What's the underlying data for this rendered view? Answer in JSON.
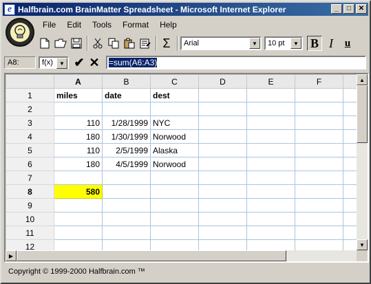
{
  "window": {
    "title": "Halfbrain.com BrainMatter Spreadsheet - Microsoft Internet Explorer",
    "minimize": "_",
    "maximize": "□",
    "close": "✕"
  },
  "menu": [
    "File",
    "Edit",
    "Tools",
    "Format",
    "Help"
  ],
  "toolbar": {
    "font": "Arial",
    "font_size": "10 pt",
    "bold_label": "B",
    "italic_label": "I",
    "underline_label": "u",
    "sum_label": "Σ",
    "new_icon": "new-document-icon",
    "open_icon": "open-folder-icon",
    "save_icon": "save-disk-icon",
    "cut_icon": "cut-scissors-icon",
    "copy_icon": "copy-icon",
    "paste_icon": "paste-clipboard-icon",
    "properties_icon": "properties-icon"
  },
  "formula_bar": {
    "cell_ref": "A8:",
    "fx_label": "f(x)",
    "confirm": "✔",
    "cancel": "✕",
    "formula": "=sum(A6:A3)"
  },
  "grid": {
    "columns": [
      "A",
      "B",
      "C",
      "D",
      "E",
      "F"
    ],
    "rows": [
      {
        "num": "1",
        "cells": [
          "miles",
          "date",
          "dest",
          "",
          "",
          ""
        ]
      },
      {
        "num": "2",
        "cells": [
          "",
          "",
          "",
          "",
          "",
          ""
        ]
      },
      {
        "num": "3",
        "cells": [
          "110",
          "1/28/1999",
          "NYC",
          "",
          "",
          ""
        ]
      },
      {
        "num": "4",
        "cells": [
          "180",
          "1/30/1999",
          "Norwood",
          "",
          "",
          ""
        ]
      },
      {
        "num": "5",
        "cells": [
          "110",
          "2/5/1999",
          "Alaska",
          "",
          "",
          ""
        ]
      },
      {
        "num": "6",
        "cells": [
          "180",
          "4/5/1999",
          "Norwood",
          "",
          "",
          ""
        ]
      },
      {
        "num": "7",
        "cells": [
          "",
          "",
          "",
          "",
          "",
          ""
        ]
      },
      {
        "num": "8",
        "cells": [
          "580",
          "",
          "",
          "",
          "",
          ""
        ]
      },
      {
        "num": "9",
        "cells": [
          "",
          "",
          "",
          "",
          "",
          ""
        ]
      },
      {
        "num": "10",
        "cells": [
          "",
          "",
          "",
          "",
          "",
          ""
        ]
      },
      {
        "num": "11",
        "cells": [
          "",
          "",
          "",
          "",
          "",
          ""
        ]
      },
      {
        "num": "12",
        "cells": [
          "",
          "",
          "",
          "",
          "",
          ""
        ]
      }
    ],
    "active_cell": "A8",
    "active_color": "#ffff00"
  },
  "status": "Copyright © 1999-2000 Halfbrain.com ™"
}
